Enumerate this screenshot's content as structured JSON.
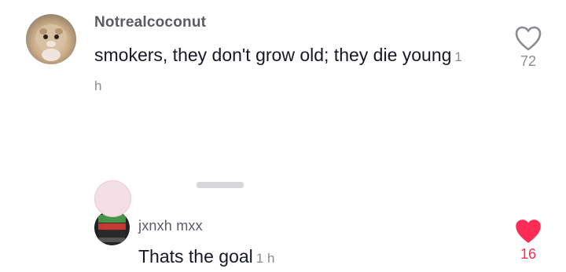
{
  "comments": [
    {
      "username": "Notrealcoconut",
      "text": "smokers, they don't grow old; they die young",
      "time": "1 h",
      "likes": "72",
      "liked": false
    },
    {
      "username": "jxnxh mxx",
      "text": "Thats the goal",
      "time": "1 h",
      "likes": "16",
      "liked": true
    }
  ],
  "colors": {
    "like_active": "#fe2c55",
    "like_inactive": "#8a8b91",
    "username": "#5a5b63",
    "text": "#161823"
  },
  "icons": {
    "like": "heart-icon"
  }
}
